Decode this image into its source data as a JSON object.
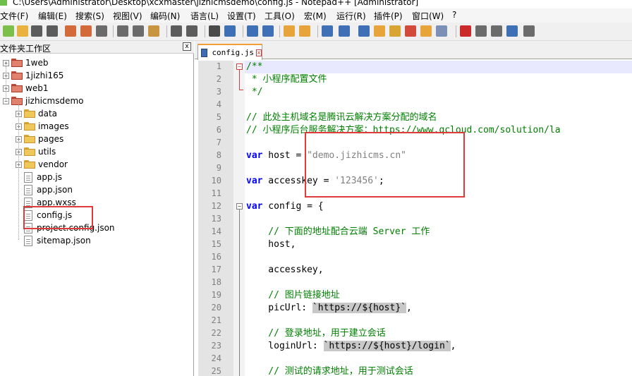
{
  "window": {
    "title": "C:\\Users\\Administrator\\Desktop\\xcxmaster\\jizhicmsdemo\\config.js - Notepad++ [Administrator]"
  },
  "menu": {
    "items": [
      {
        "label": "文件(F)"
      },
      {
        "label": "编辑(E)"
      },
      {
        "label": "搜索(S)"
      },
      {
        "label": "视图(V)"
      },
      {
        "label": "编码(N)"
      },
      {
        "label": "语言(L)"
      },
      {
        "label": "设置(T)"
      },
      {
        "label": "工具(O)"
      },
      {
        "label": "宏(M)"
      },
      {
        "label": "运行(R)"
      },
      {
        "label": "插件(P)"
      },
      {
        "label": "窗口(W)"
      },
      {
        "label": "?"
      }
    ]
  },
  "toolbar": {
    "buttons": [
      {
        "icon": "new-file-icon",
        "color": "#7cbf4a"
      },
      {
        "icon": "open-file-icon",
        "color": "#e9b23f"
      },
      {
        "icon": "save-icon",
        "color": "#5c5c5c"
      },
      {
        "icon": "save-all-icon",
        "color": "#5c5c5c"
      },
      {
        "icon": "close-icon",
        "color": "#d46a3a"
      },
      {
        "icon": "close-all-icon",
        "color": "#d46a3a"
      },
      {
        "icon": "print-icon",
        "color": "#6b6b6b"
      },
      {
        "icon": "cut-icon",
        "color": "#6b6b6b"
      },
      {
        "icon": "copy-icon",
        "color": "#6b6b6b"
      },
      {
        "icon": "paste-icon",
        "color": "#c89640"
      },
      {
        "icon": "undo-icon",
        "color": "#5c5c5c"
      },
      {
        "icon": "redo-icon",
        "color": "#5c5c5c"
      },
      {
        "icon": "find-icon",
        "color": "#4a4a4a"
      },
      {
        "icon": "replace-icon",
        "color": "#3f6fb5"
      },
      {
        "icon": "zoom-in-icon",
        "color": "#3f6fb5"
      },
      {
        "icon": "zoom-out-icon",
        "color": "#3f6fb5"
      },
      {
        "icon": "sync-vertical-icon",
        "color": "#e6a43a"
      },
      {
        "icon": "sync-horizontal-icon",
        "color": "#e6a43a"
      },
      {
        "icon": "word-wrap-icon",
        "color": "#3f6fb5"
      },
      {
        "icon": "show-all-chars-icon",
        "color": "#3f6fb5"
      },
      {
        "icon": "indent-guide-icon",
        "color": "#3f6fb5"
      },
      {
        "icon": "udl-icon",
        "color": "#e6a43a"
      },
      {
        "icon": "doc-map-icon",
        "color": "#d9a532"
      },
      {
        "icon": "function-list-icon",
        "color": "#d24a3a"
      },
      {
        "icon": "folder-as-workspace-icon",
        "color": "#e6a43a"
      },
      {
        "icon": "monitoring-icon",
        "color": "#7c8fb5"
      },
      {
        "icon": "record-macro-icon",
        "color": "#cc2a2a"
      },
      {
        "icon": "stop-record-icon",
        "color": "#6b6b6b"
      },
      {
        "icon": "play-macro-icon",
        "color": "#6b6b6b"
      },
      {
        "icon": "run-macro-multiple-icon",
        "color": "#3f6fb5"
      },
      {
        "icon": "save-macro-icon",
        "color": "#6b6b6b"
      }
    ]
  },
  "folder_panel": {
    "title": "文件夹工作区",
    "close_label": "x",
    "items": [
      {
        "label": "1web",
        "type": "folder",
        "expander": "+"
      },
      {
        "label": "1jizhi165",
        "type": "folder",
        "expander": "+"
      },
      {
        "label": "web1",
        "type": "folder",
        "expander": "+"
      },
      {
        "label": "jizhicmsdemo",
        "type": "folder",
        "expander": "−"
      },
      {
        "label": "data",
        "type": "folder",
        "expander": "+"
      },
      {
        "label": "images",
        "type": "folder",
        "expander": "+"
      },
      {
        "label": "pages",
        "type": "folder",
        "expander": "+"
      },
      {
        "label": "utils",
        "type": "folder",
        "expander": "+"
      },
      {
        "label": "vendor",
        "type": "folder",
        "expander": "+"
      },
      {
        "label": "app.js",
        "type": "file"
      },
      {
        "label": "app.json",
        "type": "file"
      },
      {
        "label": "app.wxss",
        "type": "file"
      },
      {
        "label": "config.js",
        "type": "file"
      },
      {
        "label": "project.config.json",
        "type": "file"
      },
      {
        "label": "sitemap.json",
        "type": "file"
      }
    ]
  },
  "editor": {
    "tab_label": "config.js",
    "tab_close": "x",
    "line_numbers": [
      "1",
      "2",
      "3",
      "4",
      "5",
      "6",
      "7",
      "8",
      "9",
      "10",
      "11",
      "12",
      "13",
      "14",
      "15",
      "16",
      "17",
      "18",
      "19",
      "20",
      "21",
      "22",
      "23",
      "24",
      "25"
    ],
    "fold_markers": [
      "−",
      "−"
    ],
    "lines": {
      "l1": "/**",
      "l2": " * 小程序配置文件",
      "l3": " */",
      "l5": "// 此处主机域名是腾讯云解决方案分配的域名",
      "l6": "// 小程序后台服务解决方案：https://www.qcloud.com/solution/la",
      "l8_kw": "var",
      "l8_id": " host = ",
      "l8_str": "\"demo.jizhicms.cn\"",
      "l10_kw": "var",
      "l10_id": " accesskey = ",
      "l10_str": "'123456'",
      "l10_end": ";",
      "l12_kw": "var",
      "l12_id": " config = {",
      "l14": "    // 下面的地址配合云端 Server 工作",
      "l15": "    host,",
      "l17": "    accesskey,",
      "l19": "    // 图片链接地址",
      "l20_key": "    picUrl: ",
      "l20_tpl": "`https://${host}`",
      "l20_end": ",",
      "l22": "    // 登录地址，用于建立会话",
      "l23_key": "    loginUrl: ",
      "l23_tpl": "`https://${host}/login`",
      "l23_end": ",",
      "l25": "    // 测试的请求地址，用于测试会话"
    }
  },
  "colors": {
    "comment": "#008000",
    "keyword": "#0000ff",
    "string": "#808080",
    "annotation": "#e03b3b"
  }
}
